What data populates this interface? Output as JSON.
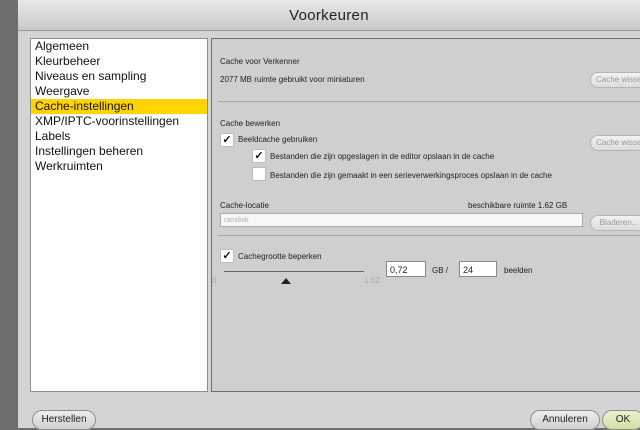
{
  "window": {
    "title": "Voorkeuren"
  },
  "sidebar": {
    "items": [
      {
        "label": "Algemeen",
        "selected": false
      },
      {
        "label": "Kleurbeheer",
        "selected": false
      },
      {
        "label": "Niveaus en sampling",
        "selected": false
      },
      {
        "label": "Weergave",
        "selected": false
      },
      {
        "label": "Cache-instellingen",
        "selected": true
      },
      {
        "label": "XMP/IPTC-voorinstellingen",
        "selected": false
      },
      {
        "label": "Labels",
        "selected": false
      },
      {
        "label": "Instellingen beheren",
        "selected": false
      },
      {
        "label": "Werkruimten",
        "selected": false
      }
    ],
    "selected_color": "#ffd400"
  },
  "cache_browser": {
    "heading": "Cache voor Verkenner",
    "usage_text": "2077 MB ruimte gebruikt voor miniaturen",
    "clear_button": "Cache wissen"
  },
  "cache_edit": {
    "heading": "Cache bewerken",
    "use_image_cache": {
      "label": "Beeldcache gebruiken",
      "checked": true
    },
    "save_editor": {
      "label": "Bestanden die zijn opgeslagen in de editor opslaan in de cache",
      "checked": true
    },
    "save_batch": {
      "label": "Bestanden die zijn gemaakt in een serieverwerkingsproces opslaan in de cache",
      "checked": false
    },
    "clear_button": "Cache wissen"
  },
  "cache_location": {
    "heading": "Cache-locatie",
    "available_space": "beschikbare ruimte 1.62 GB",
    "path_value": "ramdisk",
    "browse_button": "Bladeren..."
  },
  "cache_size": {
    "limit_label": "Cachegrootte beperken",
    "limit_checked": true,
    "slider_min": "0",
    "slider_max": "1.62",
    "slider_value": 0.72,
    "gb_value": "0,72",
    "gb_unit": "GB /",
    "frames_value": "24",
    "frames_unit": "beelden"
  },
  "footer": {
    "reset_button": "Herstellen",
    "cancel_button": "Annuleren",
    "ok_button": "OK"
  },
  "check_glyph": "✓"
}
